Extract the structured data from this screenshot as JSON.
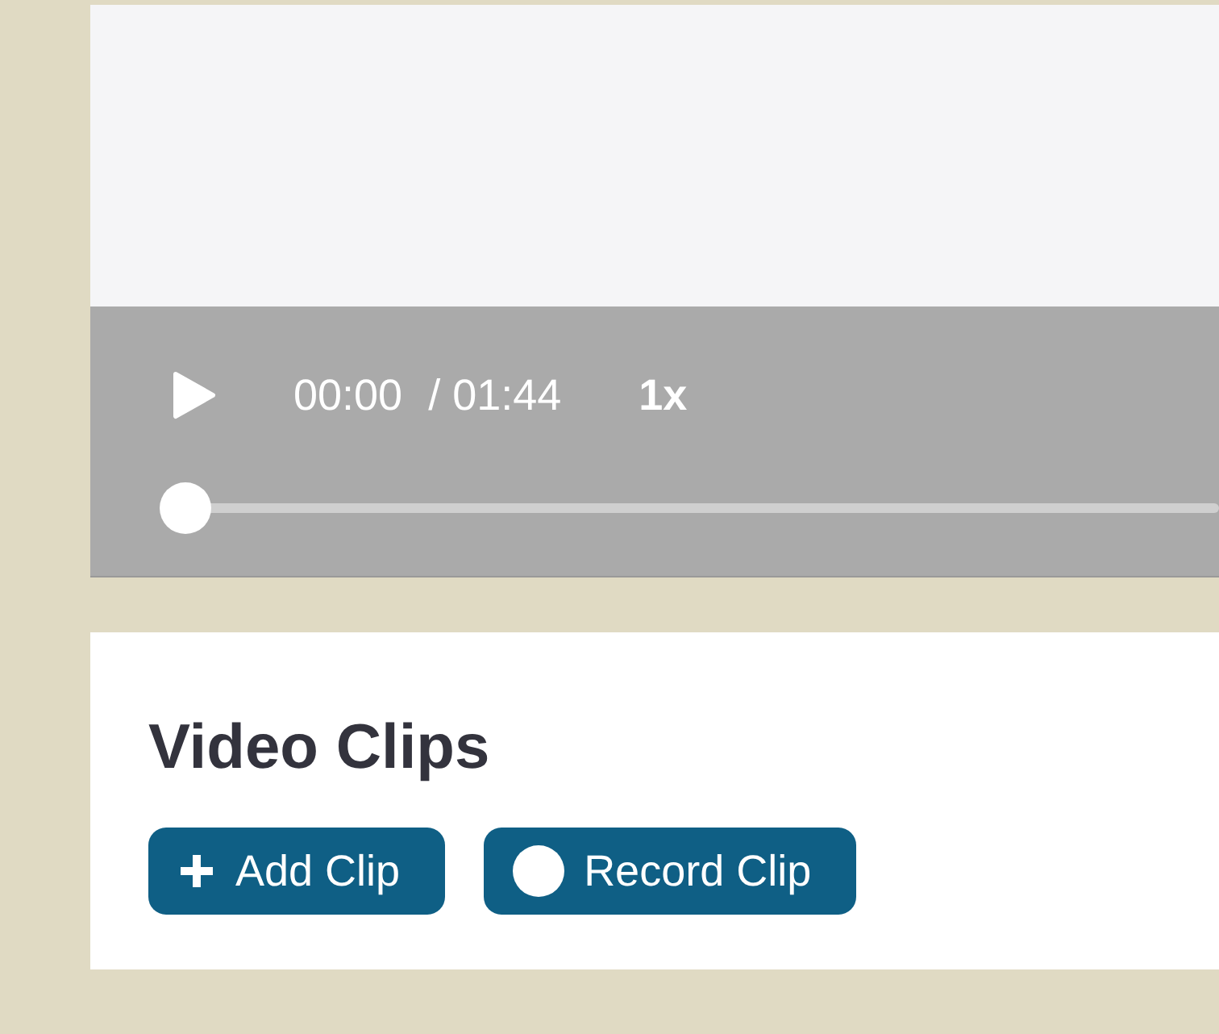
{
  "player": {
    "current_time": "00:00",
    "duration": "/ 01:44",
    "speed": "1x",
    "progress": {
      "level": 0
    }
  },
  "clips": {
    "title": "Video Clips",
    "buttons": [
      {
        "kind": "add",
        "label": "Add Clip"
      },
      {
        "kind": "record",
        "label": "Record Clip"
      }
    ]
  }
}
